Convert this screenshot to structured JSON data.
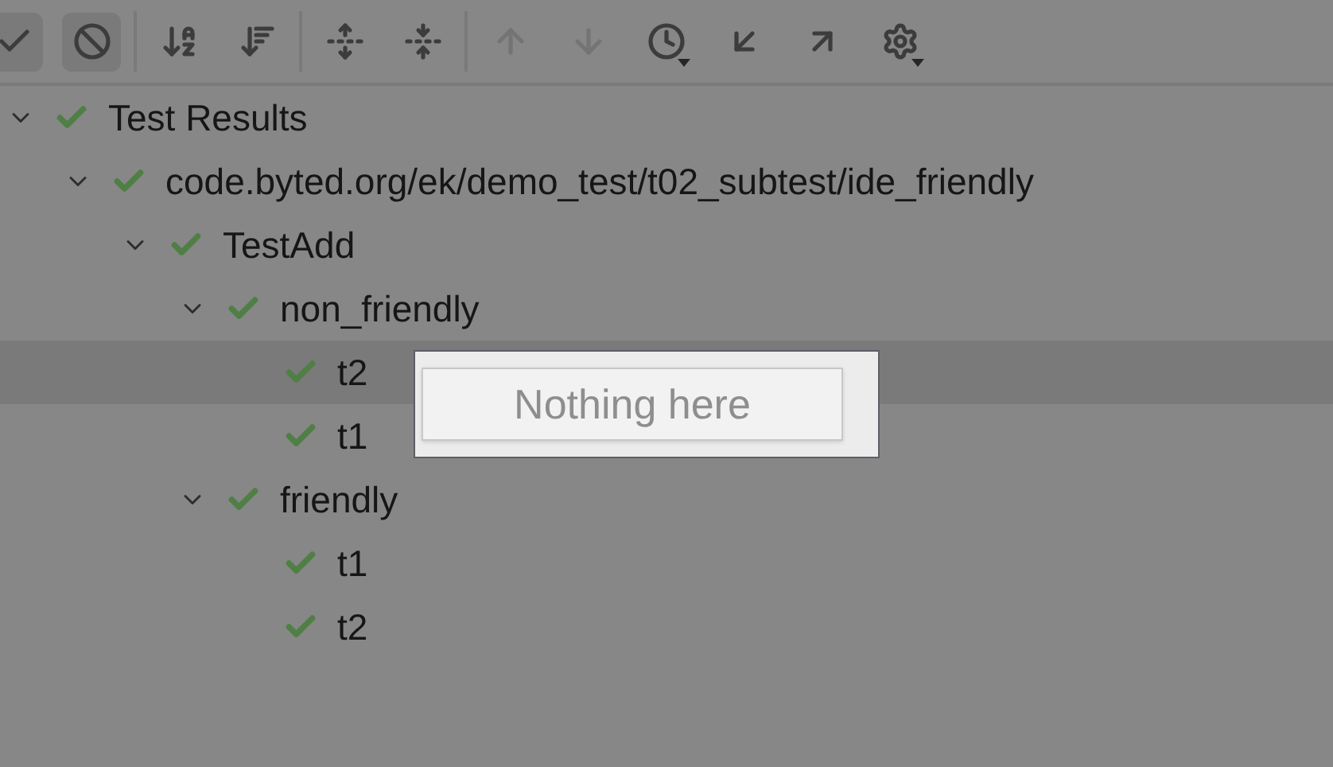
{
  "toolbar": {
    "groups": [
      [
        {
          "kind": "toggle",
          "on": true
        },
        {
          "kind": "toggle",
          "on": true
        }
      ],
      [
        {
          "kind": "action",
          "disabled": false
        },
        {
          "kind": "action",
          "disabled": false
        }
      ],
      [
        {
          "kind": "action",
          "disabled": false
        },
        {
          "kind": "action",
          "disabled": false
        }
      ],
      [
        {
          "kind": "action",
          "disabled": true
        },
        {
          "kind": "action",
          "disabled": true
        },
        {
          "kind": "menu",
          "disabled": false
        },
        {
          "kind": "action",
          "disabled": false
        },
        {
          "kind": "action",
          "disabled": false
        },
        {
          "kind": "menu",
          "disabled": false
        }
      ]
    ]
  },
  "tree": [
    {
      "label": "Test Results",
      "passed": true,
      "expanded": true,
      "selected": false,
      "children": [
        {
          "label": "code.byted.org/ek/demo_test/t02_subtest/ide_friendly",
          "passed": true,
          "expanded": true,
          "selected": false,
          "children": [
            {
              "label": "TestAdd",
              "passed": true,
              "expanded": true,
              "selected": false,
              "children": [
                {
                  "label": "non_friendly",
                  "passed": true,
                  "expanded": true,
                  "selected": false,
                  "children": [
                    {
                      "label": "t2",
                      "passed": true,
                      "selected": true
                    },
                    {
                      "label": "t1",
                      "passed": true,
                      "selected": false
                    }
                  ]
                },
                {
                  "label": "friendly",
                  "passed": true,
                  "expanded": true,
                  "selected": false,
                  "children": [
                    {
                      "label": "t1",
                      "passed": true,
                      "selected": false
                    },
                    {
                      "label": "t2",
                      "passed": true,
                      "selected": false
                    }
                  ]
                }
              ]
            }
          ]
        }
      ]
    }
  ],
  "popup": {
    "message": "Nothing here"
  }
}
